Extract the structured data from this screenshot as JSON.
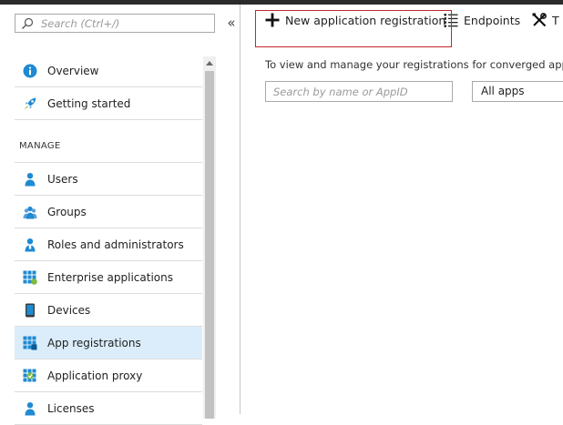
{
  "sidebar": {
    "search": {
      "placeholder": "Search (Ctrl+/)"
    },
    "collapse_label": "«",
    "items_top": [
      {
        "label": "Overview",
        "icon": "info-icon"
      },
      {
        "label": "Getting started",
        "icon": "rocket-icon"
      }
    ],
    "section_heading": "MANAGE",
    "items_manage": [
      {
        "label": "Users",
        "icon": "user-icon"
      },
      {
        "label": "Groups",
        "icon": "group-icon"
      },
      {
        "label": "Roles and administrators",
        "icon": "role-user-icon"
      },
      {
        "label": "Enterprise applications",
        "icon": "enterprise-apps-icon"
      },
      {
        "label": "Devices",
        "icon": "device-icon"
      },
      {
        "label": "App registrations",
        "icon": "app-registrations-icon",
        "selected": true
      },
      {
        "label": "Application proxy",
        "icon": "app-proxy-icon"
      },
      {
        "label": "Licenses",
        "icon": "license-icon"
      }
    ]
  },
  "toolbar": {
    "new_registration_label": "New application registration",
    "endpoints_label": "Endpoints",
    "troubleshoot_label": "T"
  },
  "main": {
    "info_text": "To view and manage your registrations for converged appli",
    "search": {
      "placeholder": "Search by name or AppID"
    },
    "filter": {
      "selected": "All apps"
    }
  },
  "colors": {
    "accent_blue": "#1f8ad2",
    "selected_bg": "#dbedfb",
    "highlight_red": "#c0282d"
  }
}
